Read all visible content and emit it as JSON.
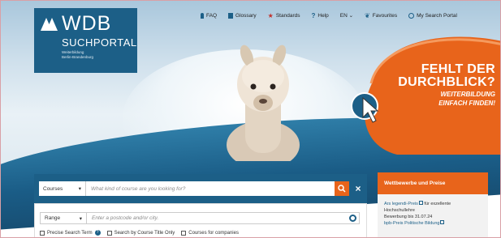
{
  "logo": {
    "title": "WDB",
    "subtitle": "SUCHPORTAL",
    "tagline_1": "Weiterbildung",
    "tagline_2": "Berlin-Brandenburg"
  },
  "nav": [
    {
      "label": "FAQ",
      "icon": "lightbulb-icon"
    },
    {
      "label": "Glossary",
      "icon": "book-icon"
    },
    {
      "label": "Standards",
      "icon": "star-icon"
    },
    {
      "label": "Help",
      "icon": "question-icon"
    },
    {
      "label": "EN ⌄",
      "icon": ""
    },
    {
      "label": "Favourites",
      "icon": "leaf-icon"
    },
    {
      "label": "My Search Portal",
      "icon": "user-icon"
    }
  ],
  "banner": {
    "line1": "FEHLT DER",
    "line2": "DURCHBLICK?",
    "line3": "WEITERBILDUNG",
    "line4": "EINFACH FINDEN!"
  },
  "search": {
    "category": "Courses",
    "placeholder": "What kind of course are you looking for?",
    "range": "Range",
    "location_placeholder": "Enter a postcode and/or city.",
    "options": [
      "Precise Search Term",
      "Search by Course Title Only",
      "Courses for companies"
    ]
  },
  "panel": {
    "title": "Wettbewerbe und Preise",
    "line1": "Ars legendi-Preis",
    "line1b": "für exzellente",
    "line2": "Hochschullehre",
    "line3": "Bewerbung bis 31.07.24",
    "line4": "bpb-Preis Politische Bildung"
  },
  "colors": {
    "brand_blue": "#1c5f87",
    "accent_orange": "#e8641b"
  }
}
